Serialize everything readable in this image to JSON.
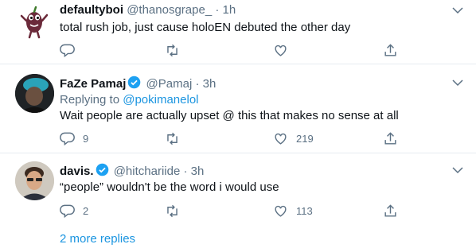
{
  "colors": {
    "accent": "#1b95e0",
    "muted": "#5b7083",
    "text": "#0f1419",
    "divider": "#e6ecf0"
  },
  "tweets": [
    {
      "name": "defaultyboi",
      "verified": false,
      "handle": "@thanosgrape_",
      "separator": "·",
      "time": "1h",
      "replying_to_label": "",
      "replying_to_handle": "",
      "text": "total rush job, just cause holoEN debuted the other day",
      "reply_count": "",
      "retweet_count": "",
      "like_count": ""
    },
    {
      "name": "FaZe Pamaj",
      "verified": true,
      "handle": "@Pamaj",
      "separator": "·",
      "time": "3h",
      "replying_to_label": "Replying to",
      "replying_to_handle": "@pokimanelol",
      "text": "Wait people are actually upset @ this that makes no sense at all",
      "reply_count": "9",
      "retweet_count": "",
      "like_count": "219"
    },
    {
      "name": "davis.",
      "verified": true,
      "handle": "@hitchariide",
      "separator": "·",
      "time": "3h",
      "replying_to_label": "",
      "replying_to_handle": "",
      "text": "“people” wouldn't be the word i would use",
      "reply_count": "2",
      "retweet_count": "",
      "like_count": "113"
    }
  ],
  "more_replies": "2 more replies"
}
